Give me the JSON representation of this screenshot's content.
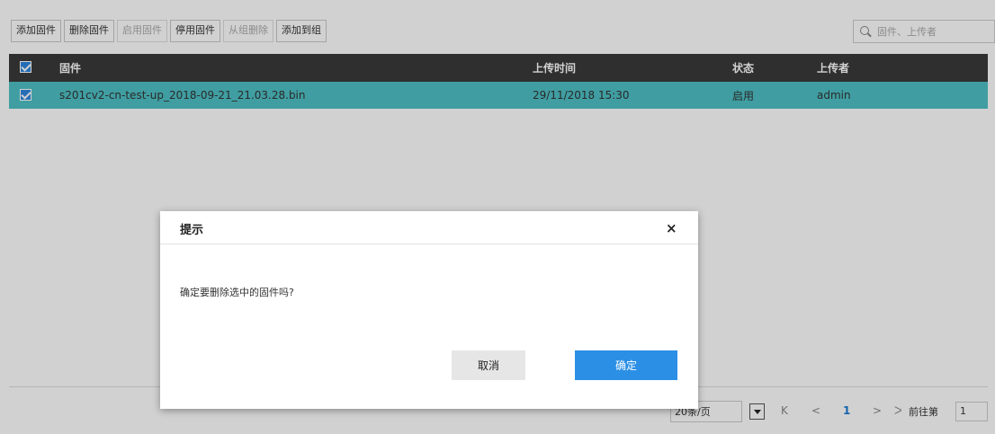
{
  "toolbar": {
    "buttons": [
      {
        "label": "添加固件",
        "enabled": true
      },
      {
        "label": "删除固件",
        "enabled": true
      },
      {
        "label": "启用固件",
        "enabled": false
      },
      {
        "label": "停用固件",
        "enabled": true
      },
      {
        "label": "从组删除",
        "enabled": false
      },
      {
        "label": "添加到组",
        "enabled": true
      }
    ],
    "search_placeholder": "固件、上传者"
  },
  "table": {
    "columns": [
      "固件",
      "上传时间",
      "状态",
      "上传者"
    ],
    "rows": [
      {
        "firmware": "s201cv2-cn-test-up_2018-09-21_21.03.28.bin",
        "upload_time": "29/11/2018 15:30",
        "status": "启用",
        "uploader": "admin",
        "selected": true
      }
    ]
  },
  "pager": {
    "page_size": "20条/页",
    "first": "K",
    "prev": "<",
    "current_page": "1",
    "next": ">",
    "last": "ᐳ",
    "goto_label": "前往第",
    "goto_value": "1"
  },
  "dialog": {
    "title": "提示",
    "close": "×",
    "message": "确定要删除选中的固件吗?",
    "cancel_label": "取消",
    "ok_label": "确定"
  },
  "colors": {
    "header_bg": "#3a3a3a",
    "selected_row_bg": "#4fc1c6",
    "primary": "#2b8fe6",
    "checkbox": "#2e86de"
  }
}
